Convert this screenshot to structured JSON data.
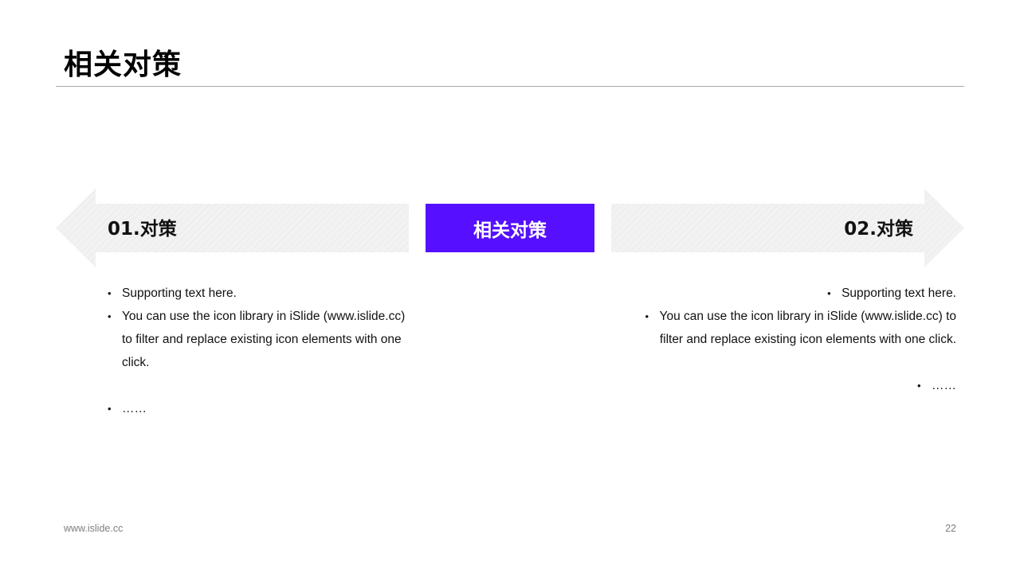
{
  "title": "相关对策",
  "colors": {
    "accent": "#5610FF",
    "arrow_fill": "#F2F2F2",
    "rule": "#A6A6A6",
    "footer_text": "#7F7F7F"
  },
  "left_block": {
    "label": "01.对策",
    "bullets": [
      "Supporting text here.",
      "You can use the icon library in iSlide (www.islide.cc) to filter and replace existing icon elements with one click.",
      "……"
    ]
  },
  "center_box": {
    "label": "相关对策"
  },
  "right_block": {
    "label": "02.对策",
    "bullets": [
      "Supporting text here.",
      "You can use the icon library in iSlide  (www.islide.cc) to filter and replace existing icon elements with one click.",
      "……"
    ]
  },
  "footer": {
    "url": "www.islide.cc",
    "page_number": "22"
  }
}
